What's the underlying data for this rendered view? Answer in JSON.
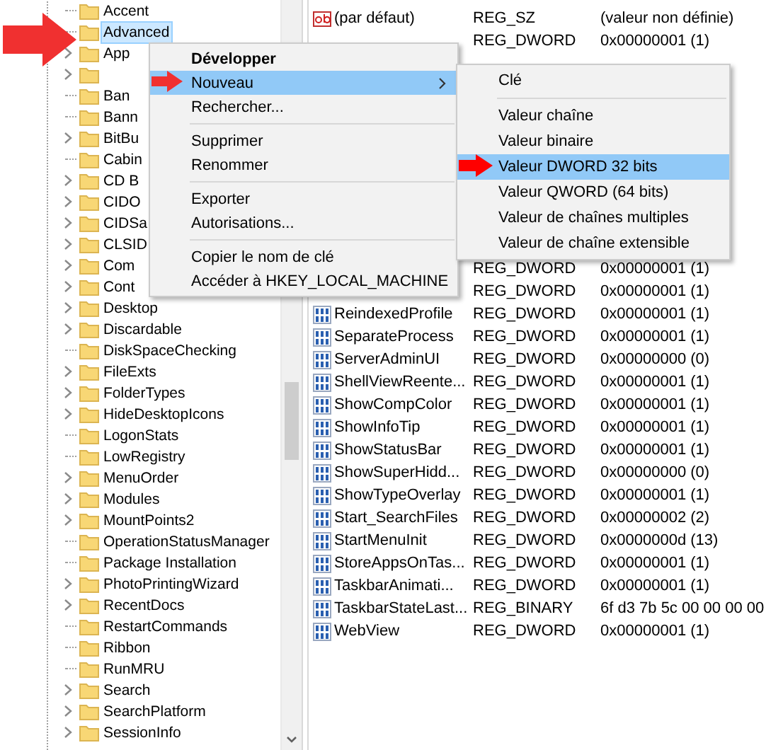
{
  "tree": {
    "items": [
      {
        "label": "Accent",
        "has_children": false,
        "selected": false
      },
      {
        "label": "Advanced",
        "has_children": false,
        "selected": true
      },
      {
        "label": "App",
        "has_children": true,
        "selected": false
      },
      {
        "has_children": true
      },
      {
        "label": "Ban",
        "has_children": false,
        "selected": false
      },
      {
        "label": "Bann",
        "has_children": false,
        "selected": false
      },
      {
        "label": "BitBu",
        "has_children": true,
        "selected": false
      },
      {
        "label": "Cabin",
        "has_children": false,
        "selected": false
      },
      {
        "label": "CD B",
        "has_children": true,
        "selected": false
      },
      {
        "label": "CIDO",
        "has_children": true,
        "selected": false
      },
      {
        "label": "CIDSa",
        "has_children": true,
        "selected": false
      },
      {
        "label": "CLSID",
        "has_children": true,
        "selected": false
      },
      {
        "label": "Com",
        "has_children": true,
        "selected": false
      },
      {
        "label": "Cont",
        "has_children": true,
        "selected": false
      },
      {
        "label": "Desktop",
        "has_children": true,
        "selected": false
      },
      {
        "label": "Discardable",
        "has_children": true,
        "selected": false
      },
      {
        "label": "DiskSpaceChecking",
        "has_children": false,
        "selected": false
      },
      {
        "label": "FileExts",
        "has_children": true,
        "selected": false
      },
      {
        "label": "FolderTypes",
        "has_children": true,
        "selected": false
      },
      {
        "label": "HideDesktopIcons",
        "has_children": true,
        "selected": false
      },
      {
        "label": "LogonStats",
        "has_children": false,
        "selected": false
      },
      {
        "label": "LowRegistry",
        "has_children": false,
        "selected": false
      },
      {
        "label": "MenuOrder",
        "has_children": true,
        "selected": false
      },
      {
        "label": "Modules",
        "has_children": true,
        "selected": false
      },
      {
        "label": "MountPoints2",
        "has_children": true,
        "selected": false
      },
      {
        "label": "OperationStatusManager",
        "has_children": false,
        "selected": false
      },
      {
        "label": "Package Installation",
        "has_children": false,
        "selected": false
      },
      {
        "label": "PhotoPrintingWizard",
        "has_children": true,
        "selected": false
      },
      {
        "label": "RecentDocs",
        "has_children": true,
        "selected": false
      },
      {
        "label": "RestartCommands",
        "has_children": false,
        "selected": false
      },
      {
        "label": "Ribbon",
        "has_children": false,
        "selected": false
      },
      {
        "label": "RunMRU",
        "has_children": false,
        "selected": false
      },
      {
        "label": "Search",
        "has_children": true,
        "selected": false
      },
      {
        "label": "SearchPlatform",
        "has_children": true,
        "selected": false
      },
      {
        "label": "SessionInfo",
        "has_children": true,
        "selected": false
      }
    ]
  },
  "values": {
    "rows": [
      {
        "kind": "string",
        "name": "(par défaut)",
        "type": "REG_SZ",
        "data": "(valeur non définie)"
      },
      {
        "type": "REG_DWORD",
        "data": "0x00000001 (1)"
      },
      {
        "type": "REG_DWORD",
        "data": "0x00000001 (1)"
      },
      {
        "type": "REG_DWORD",
        "data": "0x00000001 (1)"
      },
      {
        "kind": "binary",
        "name": "ReindexedProfile",
        "type": "REG_DWORD",
        "data": "0x00000001 (1)"
      },
      {
        "kind": "binary",
        "name": "SeparateProcess",
        "type": "REG_DWORD",
        "data": "0x00000001 (1)"
      },
      {
        "kind": "binary",
        "name": "ServerAdminUI",
        "type": "REG_DWORD",
        "data": "0x00000000 (0)"
      },
      {
        "kind": "binary",
        "name": "ShellViewReente...",
        "type": "REG_DWORD",
        "data": "0x00000001 (1)"
      },
      {
        "kind": "binary",
        "name": "ShowCompColor",
        "type": "REG_DWORD",
        "data": "0x00000001 (1)"
      },
      {
        "kind": "binary",
        "name": "ShowInfoTip",
        "type": "REG_DWORD",
        "data": "0x00000001 (1)"
      },
      {
        "kind": "binary",
        "name": "ShowStatusBar",
        "type": "REG_DWORD",
        "data": "0x00000001 (1)"
      },
      {
        "kind": "binary",
        "name": "ShowSuperHidd...",
        "type": "REG_DWORD",
        "data": "0x00000000 (0)"
      },
      {
        "kind": "binary",
        "name": "ShowTypeOverlay",
        "type": "REG_DWORD",
        "data": "0x00000001 (1)"
      },
      {
        "kind": "binary",
        "name": "Start_SearchFiles",
        "type": "REG_DWORD",
        "data": "0x00000002 (2)"
      },
      {
        "kind": "binary",
        "name": "StartMenuInit",
        "type": "REG_DWORD",
        "data": "0x0000000d (13)"
      },
      {
        "kind": "binary",
        "name": "StoreAppsOnTas...",
        "type": "REG_DWORD",
        "data": "0x00000001 (1)"
      },
      {
        "kind": "binary",
        "name": "TaskbarAnimati...",
        "type": "REG_DWORD",
        "data": "0x00000001 (1)"
      },
      {
        "kind": "binary",
        "name": "TaskbarStateLast...",
        "type": "REG_BINARY",
        "data": "6f d3 7b 5c 00 00 00 00"
      },
      {
        "kind": "binary",
        "name": "WebView",
        "type": "REG_DWORD",
        "data": "0x00000001 (1)"
      }
    ]
  },
  "context_menu": {
    "items": [
      {
        "kind": "item",
        "label": "Développer",
        "bold": true,
        "selected": false
      },
      {
        "kind": "submenu",
        "label": "Nouveau",
        "bold": false,
        "selected": true
      },
      {
        "kind": "item",
        "label": "Rechercher...",
        "bold": false,
        "selected": false
      },
      {
        "kind": "separator"
      },
      {
        "kind": "item",
        "label": "Supprimer",
        "bold": false,
        "selected": false
      },
      {
        "kind": "item",
        "label": "Renommer",
        "bold": false,
        "selected": false
      },
      {
        "kind": "separator"
      },
      {
        "kind": "item",
        "label": "Exporter",
        "bold": false,
        "selected": false
      },
      {
        "kind": "item",
        "label": "Autorisations...",
        "bold": false,
        "selected": false
      },
      {
        "kind": "separator"
      },
      {
        "kind": "item",
        "label": "Copier le nom de clé",
        "bold": false,
        "selected": false
      },
      {
        "kind": "item",
        "label": "Accéder à HKEY_LOCAL_MACHINE",
        "bold": false,
        "selected": false
      }
    ]
  },
  "submenu": {
    "items": [
      {
        "kind": "item",
        "label": "Clé",
        "selected": false
      },
      {
        "kind": "separator"
      },
      {
        "kind": "item",
        "label": "Valeur chaîne",
        "selected": false
      },
      {
        "kind": "item",
        "label": "Valeur binaire",
        "selected": false
      },
      {
        "kind": "item",
        "label": "Valeur DWORD 32 bits",
        "selected": true
      },
      {
        "kind": "item",
        "label": "Valeur QWORD (64 bits)",
        "selected": false
      },
      {
        "kind": "item",
        "label": "Valeur de chaînes multiples",
        "selected": false
      },
      {
        "kind": "item",
        "label": "Valeur de chaîne extensible",
        "selected": false
      }
    ]
  }
}
